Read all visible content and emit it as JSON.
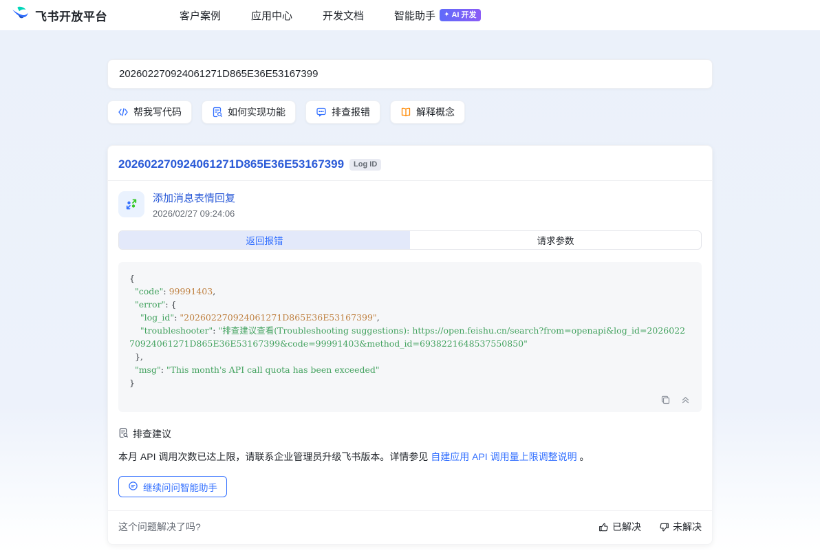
{
  "navbar": {
    "brand": "飞书开放平台",
    "items": [
      {
        "label": "客户案例"
      },
      {
        "label": "应用中心"
      },
      {
        "label": "开发文档"
      },
      {
        "label": "智能助手",
        "badge": "AI 开发"
      }
    ]
  },
  "search": {
    "value": "202602270924061271D865E36E53167399"
  },
  "quick_actions": [
    {
      "label": "帮我写代码",
      "icon": "code-icon"
    },
    {
      "label": "如何实现功能",
      "icon": "doc-search-icon"
    },
    {
      "label": "排查报错",
      "icon": "chat-bubble-icon"
    },
    {
      "label": "解释概念",
      "icon": "book-icon"
    }
  ],
  "result": {
    "title": "202602270924061271D865E36E53167399",
    "badge": "Log ID",
    "api": {
      "name": "添加消息表情回复",
      "time": "2026/02/27 09:24:06"
    },
    "tabs": [
      {
        "label": "返回报错",
        "active": true
      },
      {
        "label": "请求参数",
        "active": false
      }
    ],
    "code_lines": [
      [
        {
          "t": "{",
          "c": "p"
        }
      ],
      [
        {
          "t": "  ",
          "c": "p"
        },
        {
          "t": "\"code\"",
          "c": "k"
        },
        {
          "t": ": ",
          "c": "p"
        },
        {
          "t": "99991403",
          "c": "n"
        },
        {
          "t": ",",
          "c": "p"
        }
      ],
      [
        {
          "t": "  ",
          "c": "p"
        },
        {
          "t": "\"error\"",
          "c": "k"
        },
        {
          "t": ": {",
          "c": "p"
        }
      ],
      [
        {
          "t": "    ",
          "c": "p"
        },
        {
          "t": "\"log_id\"",
          "c": "k"
        },
        {
          "t": ": ",
          "c": "p"
        },
        {
          "t": "\"202602270924061271D865E36E53167399\"",
          "c": "n"
        },
        {
          "t": ",",
          "c": "p"
        }
      ],
      [
        {
          "t": "    ",
          "c": "p"
        },
        {
          "t": "\"troubleshooter\"",
          "c": "k"
        },
        {
          "t": ": ",
          "c": "p"
        },
        {
          "t": "\"排查建议查看(Troubleshooting suggestions): https://open.feishu.cn/search?from=openapi&log_id=202602270924061271D865E36E53167399&code=99991403&method_id=6938221648537550850\"",
          "c": "s"
        }
      ],
      [
        {
          "t": "  },",
          "c": "p"
        }
      ],
      [
        {
          "t": "  ",
          "c": "p"
        },
        {
          "t": "\"msg\"",
          "c": "k"
        },
        {
          "t": ": ",
          "c": "p"
        },
        {
          "t": "\"This month's API call quota has been exceeded\"",
          "c": "s"
        }
      ],
      [
        {
          "t": "}",
          "c": "p"
        }
      ]
    ],
    "suggestion": {
      "heading": "排查建议",
      "text_before": "本月 API 调用次数已达上限，请联系企业管理员升级飞书版本。详情参见 ",
      "link_text": "自建应用 API 调用量上限调整说明",
      "text_after": " 。",
      "ask_button": "继续问问智能助手"
    },
    "footer": {
      "question": "这个问题解决了吗?",
      "resolved": "已解决",
      "unresolved": "未解决"
    }
  },
  "colors": {
    "accent_blue": "#3370ff",
    "link_blue": "#2a5ad7",
    "code_key_green": "#43a25f",
    "code_value_orange": "#bf8040",
    "badge_gradient": "linear-gradient(90deg,#5f6bfa,#8b5cf6)",
    "icon_orange": "#ff8800",
    "icon_green": "#34c724"
  }
}
